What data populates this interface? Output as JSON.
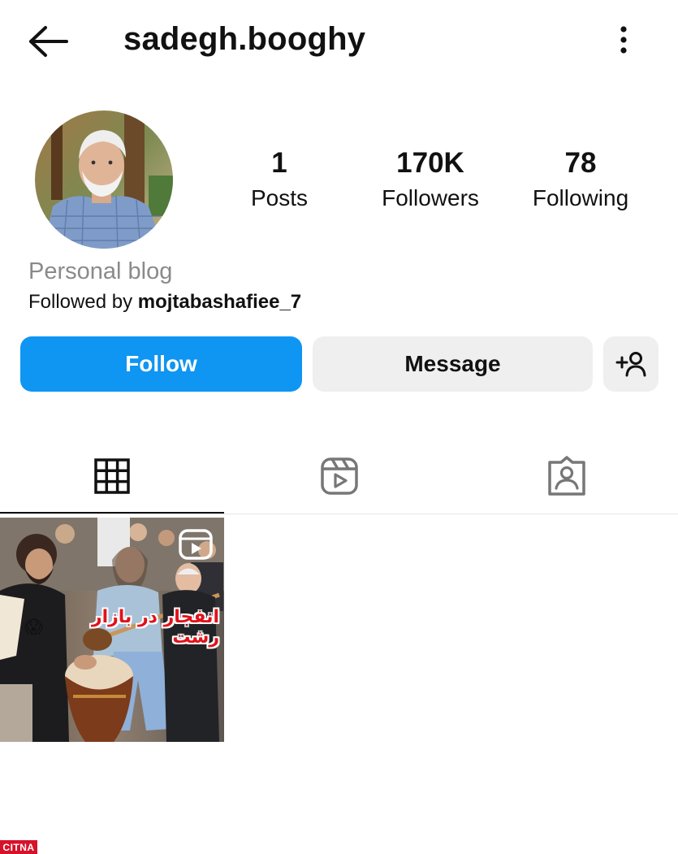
{
  "header": {
    "username": "sadegh.booghy",
    "back_icon": "arrow-left-icon",
    "menu_icon": "more-vertical-icon"
  },
  "profile": {
    "stats": [
      {
        "value": "1",
        "label": "Posts"
      },
      {
        "value": "170K",
        "label": "Followers"
      },
      {
        "value": "78",
        "label": "Following"
      }
    ],
    "category": "Personal blog",
    "followed_by_prefix": "Followed by ",
    "followed_by_user": "mojtabashafiee_7"
  },
  "actions": {
    "follow_label": "Follow",
    "message_label": "Message",
    "add_user_icon": "add-person-icon"
  },
  "tabs": [
    {
      "icon": "grid-icon",
      "active": true
    },
    {
      "icon": "reels-icon",
      "active": false
    },
    {
      "icon": "tagged-icon",
      "active": false
    }
  ],
  "posts": [
    {
      "overlay_text": "انفجار در بازار رشت",
      "emoji": "😱",
      "type": "reel"
    }
  ],
  "watermark": "CITNA",
  "colors": {
    "follow_button": "#0f95f2",
    "secondary_button": "#efefef",
    "category_text": "#8a8a8a",
    "watermark_bg": "#d8112a"
  }
}
